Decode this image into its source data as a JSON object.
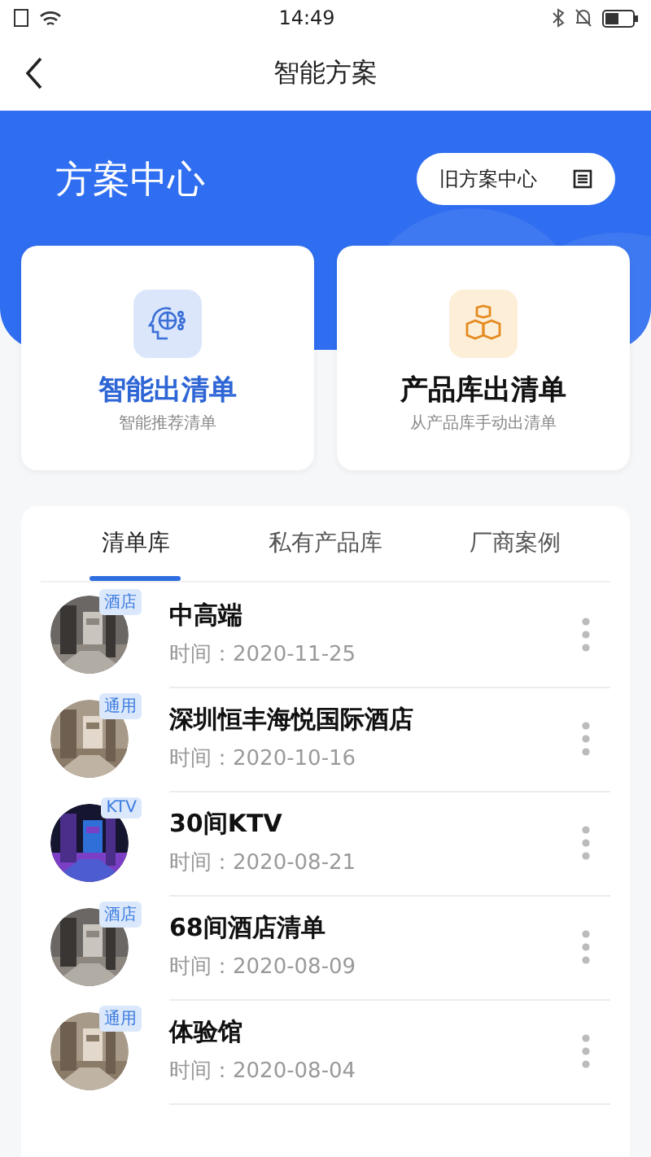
{
  "status_bar": {
    "time": "14:49"
  },
  "nav": {
    "title": "智能方案"
  },
  "hero": {
    "title": "方案中心",
    "button": "旧方案中心"
  },
  "actions": [
    {
      "kind": "ai",
      "title": "智能出清单",
      "subtitle": "智能推荐清单"
    },
    {
      "kind": "product",
      "title": "产品库出清单",
      "subtitle": "从产品库手动出清单"
    }
  ],
  "tabs": [
    {
      "label": "清单库",
      "selected": true
    },
    {
      "label": "私有产品库",
      "selected": false
    },
    {
      "label": "厂商案例",
      "selected": false
    }
  ],
  "lists": [
    {
      "tag": "酒店",
      "title": "中高端",
      "date": "时间：2020-11-25",
      "kind": "picture"
    },
    {
      "tag": "通用",
      "title": "深圳恒丰海悦国际酒店",
      "date": "时间：2020-10-16",
      "kind": "picture"
    },
    {
      "tag": "KTV",
      "title": "30间KTV",
      "date": "时间：2020-08-21",
      "kind": "picture"
    },
    {
      "tag": "酒店",
      "title": "68间酒店清单",
      "date": "时间：2020-08-09",
      "kind": "picture"
    },
    {
      "tag": "通用",
      "title": "体验馆",
      "date": "时间：2020-08-04",
      "kind": "picture"
    }
  ]
}
